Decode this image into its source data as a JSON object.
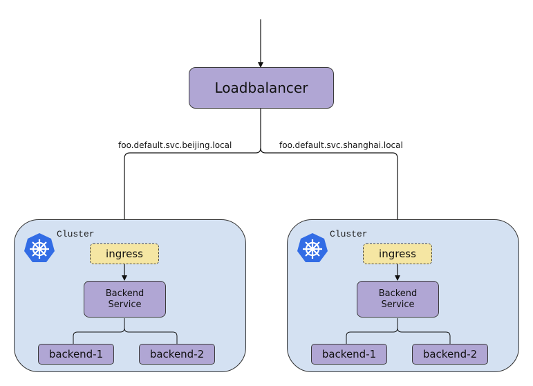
{
  "loadbalancer": {
    "label": "Loadbalancer"
  },
  "edges": {
    "left_label": "foo.default.svc.beijing.local",
    "right_label": "foo.default.svc.shanghai.local"
  },
  "clusters": [
    {
      "label": "Cluster",
      "icon": "kubernetes-icon",
      "ingress": "ingress",
      "service": {
        "line1": "Backend",
        "line2": "Service"
      },
      "backends": [
        "backend-1",
        "backend-2"
      ]
    },
    {
      "label": "Cluster",
      "icon": "kubernetes-icon",
      "ingress": "ingress",
      "service": {
        "line1": "Backend",
        "line2": "Service"
      },
      "backends": [
        "backend-1",
        "backend-2"
      ]
    }
  ],
  "colors": {
    "node_fill": "#b0a6d4",
    "cluster_fill": "#d4e1f2",
    "ingress_fill": "#f5e6a3",
    "k8s_blue": "#326ce5"
  }
}
